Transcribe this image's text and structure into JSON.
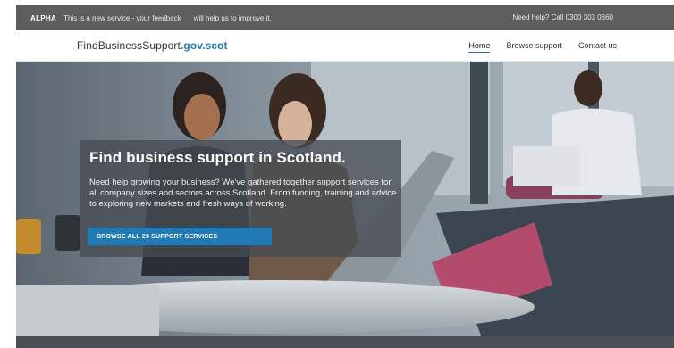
{
  "alpha_bar": {
    "tag": "ALPHA",
    "message": "This is a new service - your feedback",
    "message_link": "will help us to improve it.",
    "help": "Need help? Call 0300 303 0660"
  },
  "header": {
    "logo_main": "FindBusinessSupport",
    "logo_domain": ".gov.scot",
    "nav": [
      {
        "label": "Home",
        "active": true
      },
      {
        "label": "Browse support",
        "active": false
      },
      {
        "label": "Contact us",
        "active": false
      }
    ]
  },
  "hero": {
    "title": "Find business support in Scotland.",
    "description": "Need help growing your business? We've gathered together support services for all company sizes and sectors across Scotland. From funding, training and advice to exploring new markets and fresh ways of working.",
    "cta_label": "BROWSE ALL 23 SUPPORT SERVICES"
  },
  "colors": {
    "accent": "#1f7ab5",
    "alpha_bar": "#5d5d5d"
  }
}
